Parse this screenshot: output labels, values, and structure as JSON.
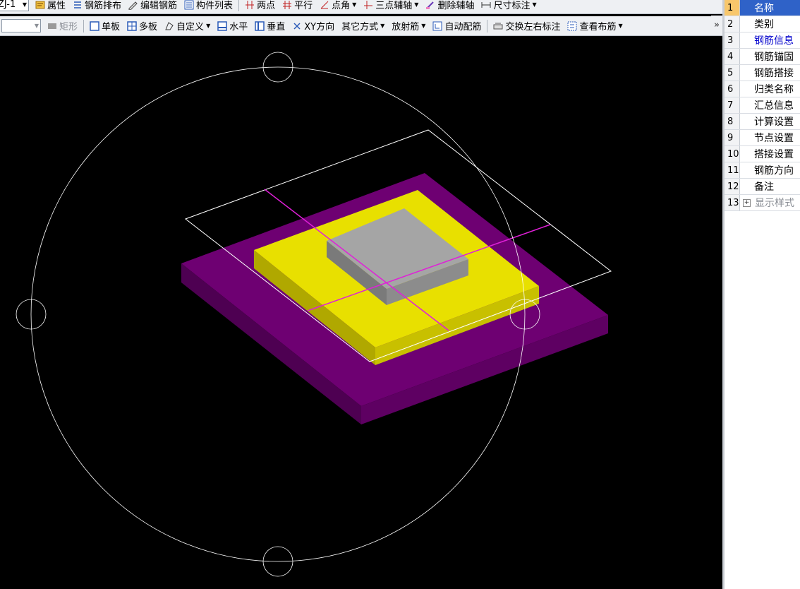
{
  "toolbar1": {
    "combo_value": "ZJ-1",
    "items": [
      {
        "label": "属性",
        "icon": "properties-icon"
      },
      {
        "label": "钢筋排布",
        "icon": "rebar-layout-icon"
      },
      {
        "label": "编辑钢筋",
        "icon": "edit-rebar-icon"
      },
      {
        "label": "构件列表",
        "icon": "component-list-icon"
      },
      {
        "label": "两点",
        "icon": "two-point-icon"
      },
      {
        "label": "平行",
        "icon": "parallel-icon"
      },
      {
        "label": "点角",
        "icon": "point-angle-icon"
      },
      {
        "label": "三点辅轴",
        "icon": "three-point-axis-icon"
      },
      {
        "label": "删除辅轴",
        "icon": "delete-axis-icon"
      },
      {
        "label": "尺寸标注",
        "icon": "dimension-icon"
      }
    ]
  },
  "toolbar2": {
    "items": [
      {
        "label": "矩形",
        "icon": "rectangle-icon"
      },
      {
        "label": "单板",
        "icon": "single-slab-icon"
      },
      {
        "label": "多板",
        "icon": "multi-slab-icon"
      },
      {
        "label": "自定义",
        "icon": "custom-icon"
      },
      {
        "label": "水平",
        "icon": "horizontal-icon"
      },
      {
        "label": "垂直",
        "icon": "vertical-icon"
      },
      {
        "label": "XY方向",
        "icon": "xy-direction-icon"
      },
      {
        "label": "其它方式",
        "icon": ""
      },
      {
        "label": "放射筋",
        "icon": ""
      },
      {
        "label": "自动配筋",
        "icon": "auto-rebar-icon"
      },
      {
        "label": "交换左右标注",
        "icon": "swap-labels-icon"
      },
      {
        "label": "查看布筋",
        "icon": "view-rebar-icon"
      }
    ],
    "more": "»"
  },
  "properties": [
    {
      "num": "1",
      "name": "名称"
    },
    {
      "num": "2",
      "name": "类别"
    },
    {
      "num": "3",
      "name": "钢筋信息"
    },
    {
      "num": "4",
      "name": "钢筋锚固"
    },
    {
      "num": "5",
      "name": "钢筋搭接"
    },
    {
      "num": "6",
      "name": "归类名称"
    },
    {
      "num": "7",
      "name": "汇总信息"
    },
    {
      "num": "8",
      "name": "计算设置"
    },
    {
      "num": "9",
      "name": "节点设置"
    },
    {
      "num": "10",
      "name": "搭接设置"
    },
    {
      "num": "11",
      "name": "钢筋方向"
    },
    {
      "num": "12",
      "name": "备注"
    },
    {
      "num": "13",
      "name": "显示样式",
      "expand": "+"
    }
  ],
  "colors": {
    "purple_slab": "#6e0072",
    "yellow_pad": "#e8e000",
    "grey_column": "#a5a5a5",
    "axis_line": "#e020d8",
    "canvas_bg": "#000000",
    "selected_row": "#2f62c8"
  }
}
